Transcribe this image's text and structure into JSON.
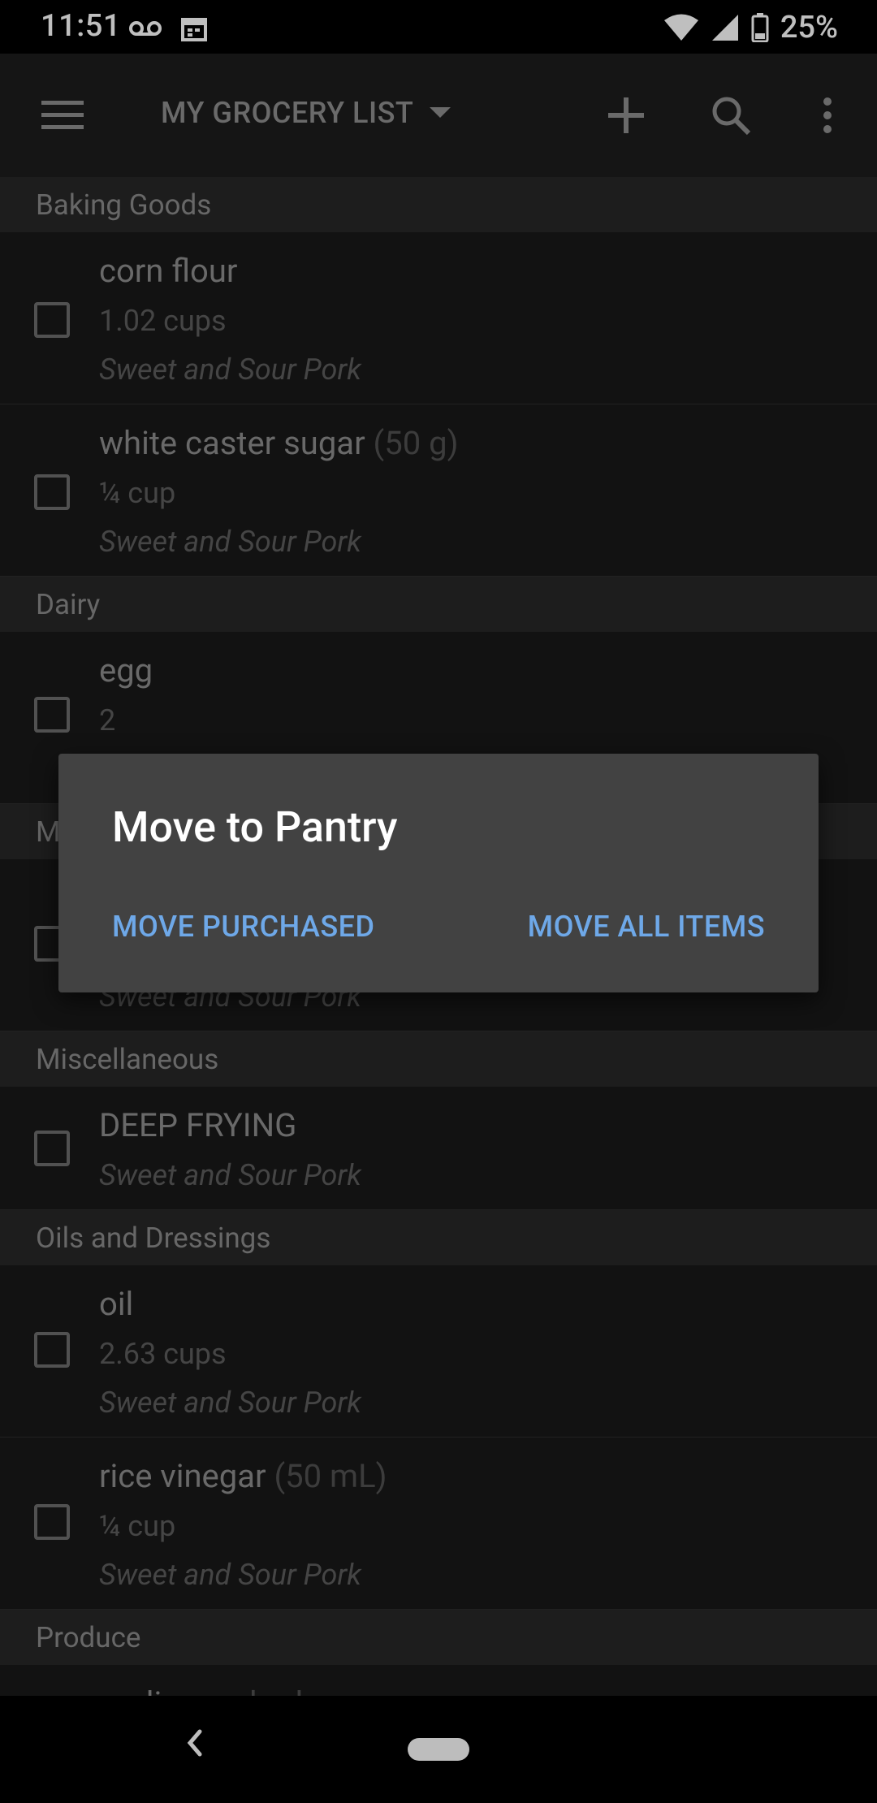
{
  "status_bar": {
    "time": "11:51",
    "battery": "25%"
  },
  "toolbar": {
    "title": "MY GROCERY LIST"
  },
  "sections": [
    {
      "header": "Baking Goods",
      "items": [
        {
          "name": "corn flour",
          "extra": "",
          "qty": "1.02 cups",
          "recipe": "Sweet and Sour Pork"
        },
        {
          "name": "white caster sugar",
          "extra": "(50 g)",
          "qty": "¼ cup",
          "recipe": "Sweet and Sour Pork"
        }
      ]
    },
    {
      "header": "Dairy",
      "items": [
        {
          "name": "egg",
          "extra": "",
          "qty": "2",
          "recipe": ""
        }
      ]
    },
    {
      "header": "M",
      "items": [
        {
          "name": "",
          "extra": "",
          "qty": "",
          "recipe": "Sweet and Sour Pork"
        }
      ]
    },
    {
      "header": "Miscellaneous",
      "items": [
        {
          "name": "DEEP FRYING",
          "extra": "",
          "qty": "",
          "recipe": "Sweet and Sour Pork"
        }
      ]
    },
    {
      "header": "Oils and Dressings",
      "items": [
        {
          "name": "oil",
          "extra": "",
          "qty": "2.63 cups",
          "recipe": "Sweet and Sour Pork"
        },
        {
          "name": "rice vinegar",
          "extra": "(50 mL)",
          "qty": "¼ cup",
          "recipe": "Sweet and Sour Pork"
        }
      ]
    },
    {
      "header": "Produce",
      "items": [
        {
          "name": "garlic",
          "extra": "crushed",
          "qty": "",
          "recipe": ""
        }
      ]
    }
  ],
  "dialog": {
    "title": "Move to Pantry",
    "button_left": "MOVE PURCHASED",
    "button_right": "MOVE ALL ITEMS"
  },
  "colors": {
    "accent": "#6ea8e8",
    "dialog_bg": "#424242",
    "list_bg": "#181818",
    "header_bg": "#272727"
  },
  "icons": [
    "voicemail-icon",
    "calendar-icon",
    "wifi-icon",
    "signal-icon",
    "battery-icon",
    "menu-icon",
    "dropdown-icon",
    "add-icon",
    "search-icon",
    "more-vert-icon",
    "back-icon",
    "home-pill-icon"
  ]
}
